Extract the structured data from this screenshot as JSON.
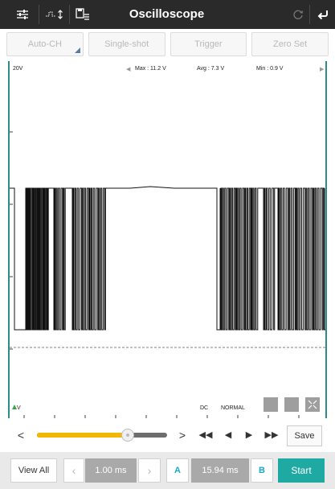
{
  "header": {
    "title": "Oscilloscope"
  },
  "modes": [
    {
      "label": "Auto-CH"
    },
    {
      "label": "Single-shot"
    },
    {
      "label": "Trigger"
    },
    {
      "label": "Zero Set"
    }
  ],
  "scope": {
    "volt_scale": "20V",
    "max": "Max : 11.2 V",
    "avg": "Avg : 7.3 V",
    "min": "Min : 0.9 V",
    "channel": "V",
    "coupling": "DC",
    "mode": "NORMAL"
  },
  "slider": {
    "position": 0.7
  },
  "toolbar": {
    "save_label": "Save",
    "view_all_label": "View All",
    "time_base": "1.00 ms",
    "cursor_a_label": "A",
    "cursor_value": "15.94 ms",
    "cursor_b_label": "B",
    "start_label": "Start"
  },
  "colors": {
    "header_bg": "#2a2a2a",
    "accent_teal": "#1fa9a3",
    "slider_fill": "#f2b705",
    "cursor_label": "#1ba8c7",
    "scope_border": "#2e8b8b"
  },
  "icons": [
    "settings-sliders-icon",
    "signal-icon",
    "save-list-icon",
    "refresh-icon",
    "back-icon"
  ]
}
